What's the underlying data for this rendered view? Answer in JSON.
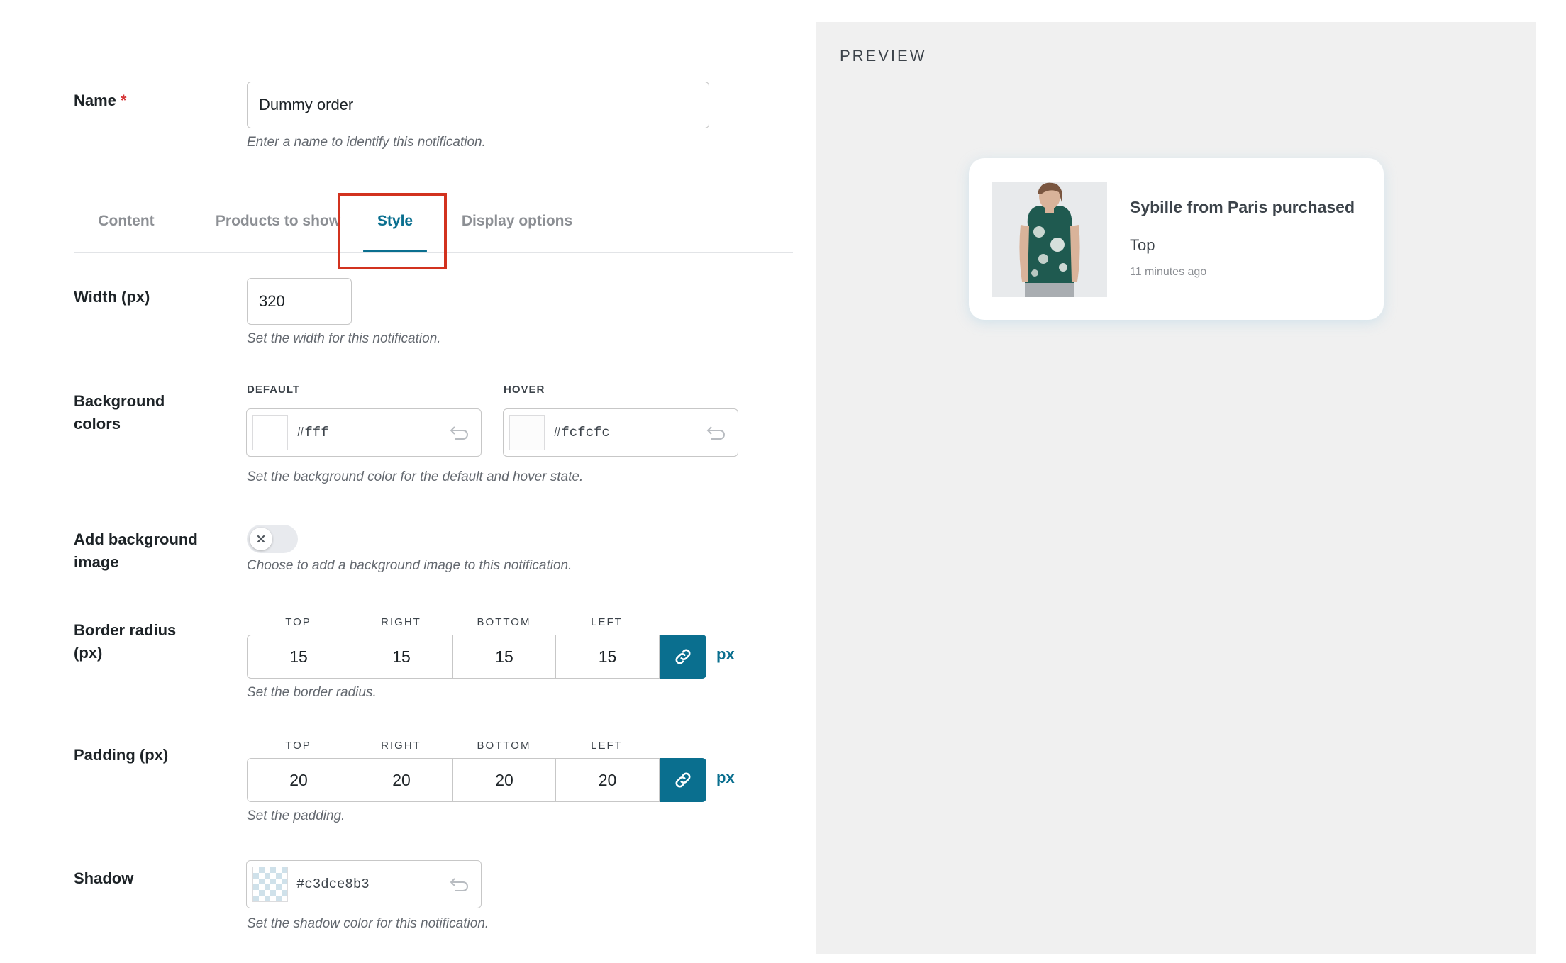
{
  "form": {
    "name": {
      "label": "Name",
      "required_mark": "*",
      "value": "Dummy order",
      "help": "Enter a name to identify this notification."
    },
    "tabs": [
      {
        "label": "Content",
        "active": false
      },
      {
        "label": "Products to show",
        "active": false
      },
      {
        "label": "Style",
        "active": true
      },
      {
        "label": "Display options",
        "active": false
      }
    ],
    "width": {
      "label": "Width (px)",
      "value": "320",
      "help": "Set the width for this notification."
    },
    "background": {
      "label_line1": "Background",
      "label_line2": "colors",
      "default_caption": "DEFAULT",
      "default_value": "#fff",
      "hover_caption": "HOVER",
      "hover_value": "#fcfcfc",
      "help": "Set the background color for the default and hover state."
    },
    "bg_image": {
      "label_line1": "Add background",
      "label_line2": "image",
      "enabled": false,
      "help": "Choose to add a background image to this notification."
    },
    "border_radius": {
      "label_line1": "Border radius",
      "label_line2": "(px)",
      "captions": [
        "TOP",
        "RIGHT",
        "BOTTOM",
        "LEFT"
      ],
      "values": [
        "15",
        "15",
        "15",
        "15"
      ],
      "unit": "px",
      "help": "Set the border radius."
    },
    "padding": {
      "label": "Padding (px)",
      "captions": [
        "TOP",
        "RIGHT",
        "BOTTOM",
        "LEFT"
      ],
      "values": [
        "20",
        "20",
        "20",
        "20"
      ],
      "unit": "px",
      "help": "Set the padding."
    },
    "shadow": {
      "label": "Shadow",
      "value": "#c3dce8b3",
      "help": "Set the shadow color for this notification."
    }
  },
  "preview": {
    "title": "PREVIEW",
    "notification": {
      "title": "Sybille from Paris purchased",
      "product": "Top",
      "time": "11 minutes ago",
      "image_icon": "product-photo-floral-top"
    }
  },
  "colors": {
    "accent": "#0a6f8f",
    "highlight": "#d2321f",
    "required": "#d63638",
    "preview_bg": "#f0f0f0",
    "shadow": "#c3dce8b3"
  }
}
